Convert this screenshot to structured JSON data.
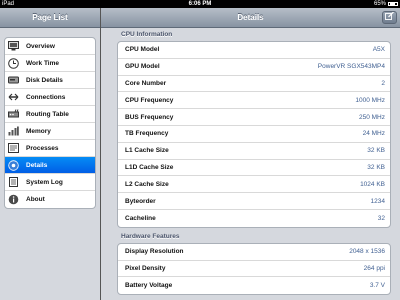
{
  "statusbar": {
    "carrier": "iPad",
    "time": "6:06 PM",
    "battery": "65%"
  },
  "left": {
    "title": "Page List",
    "items": [
      {
        "label": "Overview",
        "icon": "monitor-icon"
      },
      {
        "label": "Work Time",
        "icon": "clock-icon"
      },
      {
        "label": "Disk Details",
        "icon": "disk-icon"
      },
      {
        "label": "Connections",
        "icon": "connections-icon"
      },
      {
        "label": "Routing Table",
        "icon": "routing-icon"
      },
      {
        "label": "Memory",
        "icon": "memory-icon"
      },
      {
        "label": "Processes",
        "icon": "processes-icon"
      },
      {
        "label": "Details",
        "icon": "details-icon",
        "active": true
      },
      {
        "label": "System Log",
        "icon": "log-icon"
      },
      {
        "label": "About",
        "icon": "info-icon"
      }
    ]
  },
  "right": {
    "title": "Details",
    "compose_icon": "compose-icon",
    "cpu_section": {
      "header": "CPU Information",
      "rows": [
        {
          "label": "CPU Model",
          "value": "A5X"
        },
        {
          "label": "GPU Model",
          "value": "PowerVR SGX543MP4"
        },
        {
          "label": "Core Number",
          "value": "2"
        },
        {
          "label": "CPU Frequency",
          "value": "1000 MHz"
        },
        {
          "label": "BUS Frequency",
          "value": "250 MHz"
        },
        {
          "label": "TB Frequency",
          "value": "24 MHz"
        },
        {
          "label": "L1 Cache Size",
          "value": "32 KB"
        },
        {
          "label": "L1D Cache Size",
          "value": "32 KB"
        },
        {
          "label": "L2 Cache Size",
          "value": "1024 KB"
        },
        {
          "label": "Byteorder",
          "value": "1234"
        },
        {
          "label": "Cacheline",
          "value": "32"
        }
      ]
    },
    "hw_section": {
      "header": "Hardware Features",
      "rows": [
        {
          "label": "Display Resolution",
          "value": "2048 x 1536"
        },
        {
          "label": "Pixel Density",
          "value": "264 ppi"
        },
        {
          "label": "Battery Voltage",
          "value": "3.7 V"
        }
      ]
    }
  },
  "colors": {
    "active": "#0170ee",
    "value_text": "#3f5f91",
    "navbar": "#8793a2"
  }
}
